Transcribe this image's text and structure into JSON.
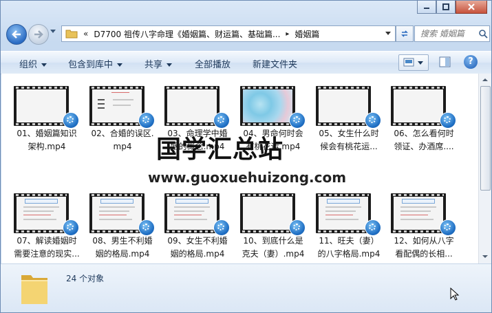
{
  "window": {
    "caption_buttons": [
      "minimize-icon",
      "maximize-icon",
      "close-icon"
    ]
  },
  "nav": {
    "back_icon": "back-arrow-icon",
    "forward_icon": "forward-arrow-icon",
    "address_prefix": "«",
    "address_path": [
      "D7700 祖传八字命理《婚姻篇、财运篇、基础篇...",
      "婚姻篇"
    ],
    "address_separator": "▸",
    "search_placeholder": "搜索 婚姻篇"
  },
  "toolbar": {
    "organize": "组织",
    "include_in_library": "包含到库中",
    "share": "共享",
    "play_all": "全部播放",
    "new_folder": "新建文件夹"
  },
  "files": [
    {
      "line1": "01、婚姻篇知识",
      "line2": "架构.mp4",
      "thumb": "blank"
    },
    {
      "line1": "02、合婚的误区.",
      "line2": "mp4",
      "thumb": "text"
    },
    {
      "line1": "03、命理学中婚",
      "line2": "姻的概念.mp4",
      "thumb": "blank"
    },
    {
      "line1": "04、男命何时会",
      "line2": "有桃花运.mp4",
      "thumb": "flowers"
    },
    {
      "line1": "05、女生什么时",
      "line2": "候会有桃花运...",
      "thumb": "blank"
    },
    {
      "line1": "06、怎么看何时",
      "line2": "领证、办酒席....",
      "thumb": "blank"
    },
    {
      "line1": "07、解读婚姻时",
      "line2": "需要注意的现实...",
      "thumb": "slide"
    },
    {
      "line1": "08、男生不利婚",
      "line2": "姻的格局.mp4",
      "thumb": "slide"
    },
    {
      "line1": "09、女生不利婚",
      "line2": "姻的格局.mp4",
      "thumb": "slide"
    },
    {
      "line1": "10、到底什么是",
      "line2": "克夫（妻）.mp4",
      "thumb": "blank"
    },
    {
      "line1": "11、旺夫（妻）",
      "line2": "的八字格局.mp4",
      "thumb": "slide"
    },
    {
      "line1": "12、如何从八字",
      "line2": "看配偶的长相...",
      "thumb": "slide"
    }
  ],
  "status": {
    "item_count": "24 个对象"
  },
  "watermark": {
    "title": "国学汇总站",
    "url": "www.guoxuehuizong.com"
  }
}
